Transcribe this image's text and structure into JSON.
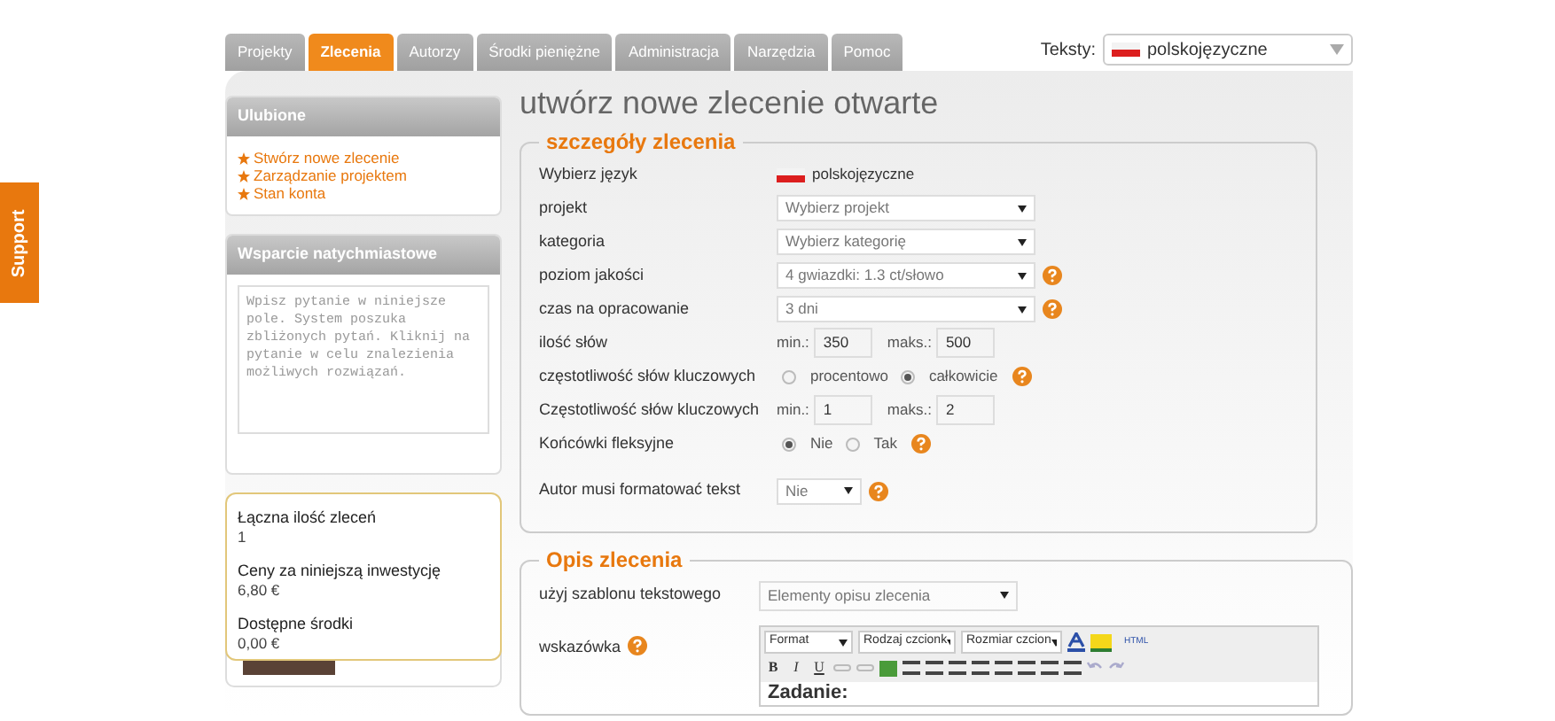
{
  "support_tab": "Support",
  "tabs": [
    {
      "label": "Projekty",
      "selected": false
    },
    {
      "label": "Zlecenia",
      "selected": true
    },
    {
      "label": "Autorzy",
      "selected": false
    },
    {
      "label": "Środki pieniężne",
      "selected": false
    },
    {
      "label": "Administracja",
      "selected": false
    },
    {
      "label": "Narzędzia",
      "selected": false
    },
    {
      "label": "Pomoc",
      "selected": false
    }
  ],
  "language_picker": {
    "label": "Teksty:",
    "value": "polskojęzyczne"
  },
  "favorites": {
    "title": "Ulubione",
    "links": [
      "Stwórz nowe zlecenie",
      "Zarządzanie projektem",
      "Stan konta"
    ]
  },
  "support_box": {
    "title": "Wsparcie natychmiastowe",
    "placeholder": "Wpisz pytanie w niniejsze pole. System poszuka zbliżonych pytań. Kliknij na pytanie w celu znalezienia możliwych rozwiązań."
  },
  "summary": [
    {
      "label": "Łączna ilość zleceń",
      "value": "1"
    },
    {
      "label": "Ceny za niniejszą inwestycję",
      "value": "6,80 €"
    },
    {
      "label": "Dostępne środki",
      "value": "0,00 €"
    }
  ],
  "page_title": "utwórz nowe zlecenie otwarte",
  "details": {
    "legend": "szczegóły zlecenia",
    "rows": [
      {
        "kind": "language",
        "label": "Wybierz język",
        "value": "polskojęzyczne"
      },
      {
        "kind": "select",
        "label": "projekt",
        "value": "Wybierz projekt",
        "help": false
      },
      {
        "kind": "select",
        "label": "kategoria",
        "value": "Wybierz kategorię",
        "help": false
      },
      {
        "kind": "select",
        "label": "poziom jakości",
        "value": "4 gwiazdki: 1.3 ct/słowo",
        "help": true
      },
      {
        "kind": "select",
        "label": "czas na opracowanie",
        "value": "3 dni",
        "help": true
      },
      {
        "kind": "range",
        "label": "ilość słów",
        "min_label": "min.:",
        "min": "350",
        "max_label": "maks.:",
        "max": "500"
      },
      {
        "kind": "radio",
        "label": "częstotliwość słów kluczowych",
        "options": [
          {
            "label": "procentowo",
            "selected": false
          },
          {
            "label": "całkowicie",
            "selected": true
          }
        ],
        "help": true
      },
      {
        "kind": "range",
        "label": "Częstotliwość słów kluczowych",
        "min_label": "min.:",
        "min": "1",
        "max_label": "maks.:",
        "max": "2"
      },
      {
        "kind": "radio",
        "label": "Końcówki fleksyjne",
        "options": [
          {
            "label": "Nie",
            "selected": true
          },
          {
            "label": "Tak",
            "selected": false
          }
        ],
        "help": true
      },
      {
        "kind": "small_select",
        "label": "Autor musi formatować tekst",
        "value": "Nie",
        "help": true
      }
    ]
  },
  "description": {
    "legend": "Opis zlecenia",
    "template_label": "użyj szablonu tekstowego",
    "template_value": "Elementy opisu zlecenia",
    "hint_label": "wskazówka",
    "editor": {
      "dropdowns": [
        "Format",
        "Rodzaj czcionk",
        "Rozmiar czcion"
      ],
      "html_button": "HTML",
      "format_buttons": [
        "B",
        "I",
        "U"
      ],
      "content": "Zadanie:"
    }
  }
}
